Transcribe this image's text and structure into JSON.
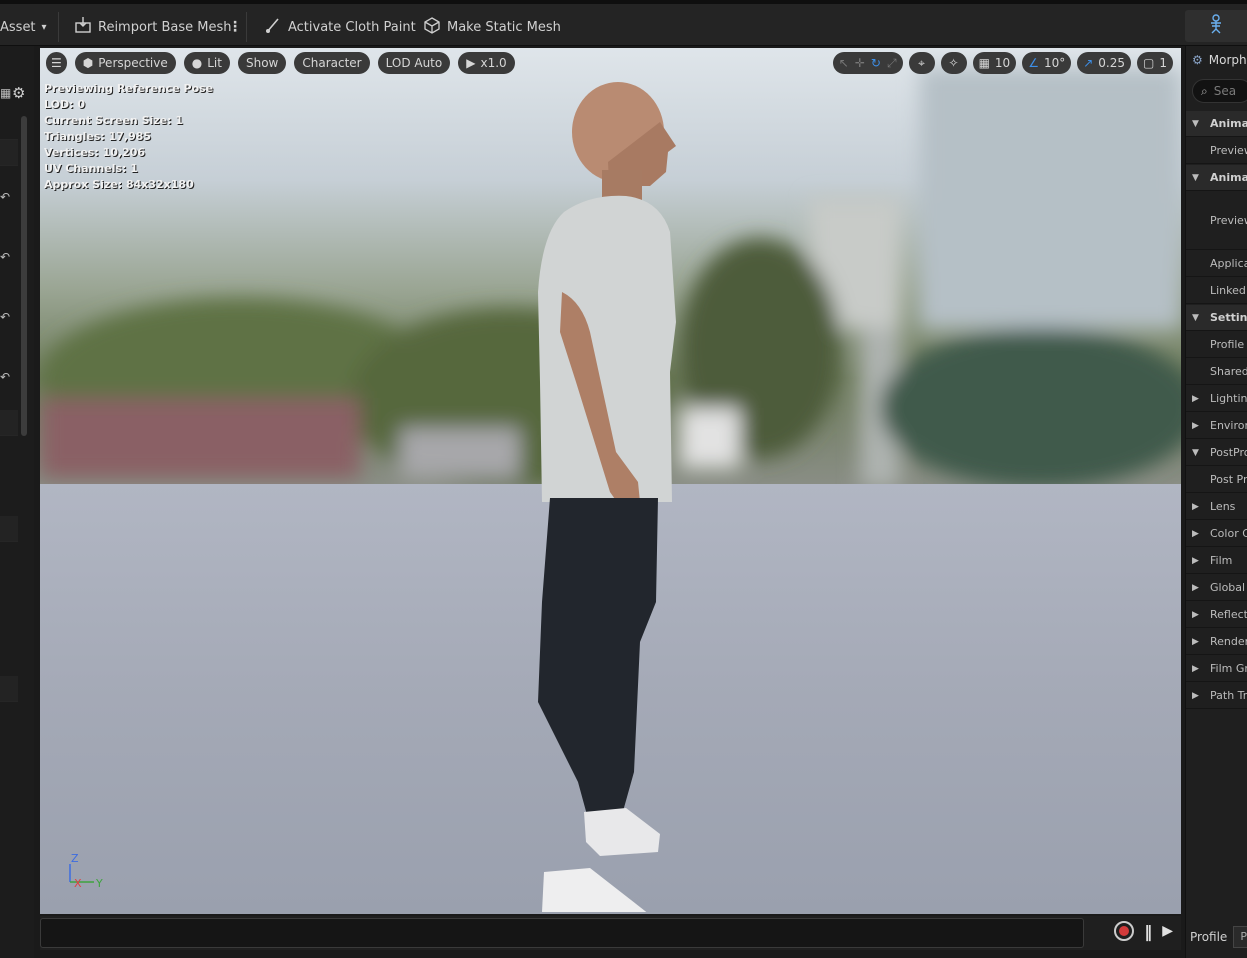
{
  "toolbar": {
    "asset_label": "Asset",
    "reimport_label": "Reimport Base Mesh",
    "cloth_paint_label": "Activate Cloth Paint",
    "static_mesh_label": "Make Static Mesh"
  },
  "viewport": {
    "perspective_label": "Perspective",
    "lit_label": "Lit",
    "show_label": "Show",
    "character_label": "Character",
    "lod_label": "LOD Auto",
    "speed_label": "x1.0",
    "grid_value": "10",
    "angle_value": "10°",
    "scale_value": "0.25",
    "camera_value": "1",
    "stats": [
      "Previewing Reference Pose",
      "LOD: 0",
      "Current Screen Size: 1",
      "Triangles: 17,985",
      "Vertices: 10,206",
      "UV Channels: 1",
      "Approx Size: 84x32x180"
    ],
    "axis": {
      "z": "Z",
      "x": "X",
      "y": "Y"
    }
  },
  "right_panel": {
    "header": "Morph",
    "search_placeholder": "Sea",
    "rows": [
      {
        "label": "Animat",
        "type": "section",
        "arrow": "▼"
      },
      {
        "label": "Preview",
        "type": "child"
      },
      {
        "label": "Animat",
        "type": "section",
        "arrow": "▼"
      },
      {
        "label": "Preview",
        "type": "child-tall"
      },
      {
        "label": "Applica",
        "type": "child"
      },
      {
        "label": "Linked",
        "type": "child"
      },
      {
        "label": "Setting",
        "type": "section",
        "arrow": "▼"
      },
      {
        "label": "Profile",
        "type": "child"
      },
      {
        "label": "Shared",
        "type": "child"
      },
      {
        "label": "Lighting",
        "type": "collapsed",
        "arrow": "▶"
      },
      {
        "label": "Environ",
        "type": "collapsed",
        "arrow": "▶"
      },
      {
        "label": "PostPro",
        "type": "expanded",
        "arrow": "▼"
      },
      {
        "label": "Post Pr",
        "type": "child"
      },
      {
        "label": "Lens",
        "type": "collapsed",
        "arrow": "▶"
      },
      {
        "label": "Color G",
        "type": "collapsed",
        "arrow": "▶"
      },
      {
        "label": "Film",
        "type": "collapsed",
        "arrow": "▶"
      },
      {
        "label": "Global I",
        "type": "collapsed",
        "arrow": "▶"
      },
      {
        "label": "Reflect",
        "type": "collapsed",
        "arrow": "▶"
      },
      {
        "label": "Render",
        "type": "collapsed",
        "arrow": "▶"
      },
      {
        "label": "Film Gr",
        "type": "collapsed",
        "arrow": "▶"
      },
      {
        "label": "Path Tr",
        "type": "collapsed",
        "arrow": "▶"
      }
    ],
    "bottom_label": "Profile",
    "bottom_value": "Pr"
  },
  "colors": {
    "accent": "#3d8fe8",
    "record": "#d23a3a"
  }
}
